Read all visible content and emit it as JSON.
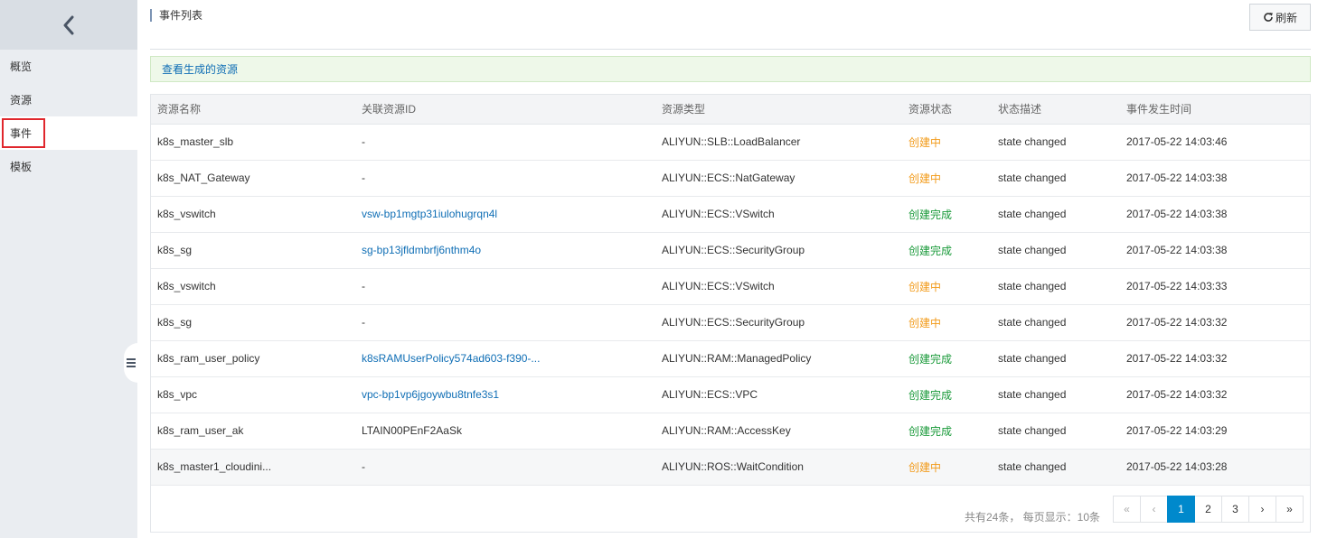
{
  "sidebar": {
    "items": [
      {
        "label": "概览",
        "active": false
      },
      {
        "label": "资源",
        "active": false
      },
      {
        "label": "事件",
        "active": true
      },
      {
        "label": "模板",
        "active": false
      }
    ]
  },
  "header": {
    "title": "事件列表",
    "refresh_label": "刷新"
  },
  "notice": {
    "link_text": "查看生成的资源"
  },
  "table": {
    "columns": [
      "资源名称",
      "关联资源ID",
      "资源类型",
      "资源状态",
      "状态描述",
      "事件发生时间"
    ],
    "rows": [
      {
        "name": "k8s_master_slb",
        "resource_id": "-",
        "id_is_link": false,
        "type": "ALIYUN::SLB::LoadBalancer",
        "status": "创建中",
        "status_kind": "orange",
        "desc": "state changed",
        "time": "2017-05-22 14:03:46"
      },
      {
        "name": "k8s_NAT_Gateway",
        "resource_id": "-",
        "id_is_link": false,
        "type": "ALIYUN::ECS::NatGateway",
        "status": "创建中",
        "status_kind": "orange",
        "desc": "state changed",
        "time": "2017-05-22 14:03:38"
      },
      {
        "name": "k8s_vswitch",
        "resource_id": "vsw-bp1mgtp31iulohugrqn4l",
        "id_is_link": true,
        "type": "ALIYUN::ECS::VSwitch",
        "status": "创建完成",
        "status_kind": "green",
        "desc": "state changed",
        "time": "2017-05-22 14:03:38"
      },
      {
        "name": "k8s_sg",
        "resource_id": "sg-bp13jfldmbrfj6nthm4o",
        "id_is_link": true,
        "type": "ALIYUN::ECS::SecurityGroup",
        "status": "创建完成",
        "status_kind": "green",
        "desc": "state changed",
        "time": "2017-05-22 14:03:38"
      },
      {
        "name": "k8s_vswitch",
        "resource_id": "-",
        "id_is_link": false,
        "type": "ALIYUN::ECS::VSwitch",
        "status": "创建中",
        "status_kind": "orange",
        "desc": "state changed",
        "time": "2017-05-22 14:03:33"
      },
      {
        "name": "k8s_sg",
        "resource_id": "-",
        "id_is_link": false,
        "type": "ALIYUN::ECS::SecurityGroup",
        "status": "创建中",
        "status_kind": "orange",
        "desc": "state changed",
        "time": "2017-05-22 14:03:32"
      },
      {
        "name": "k8s_ram_user_policy",
        "resource_id": "k8sRAMUserPolicy574ad603-f390-...",
        "id_is_link": true,
        "type": "ALIYUN::RAM::ManagedPolicy",
        "status": "创建完成",
        "status_kind": "green",
        "desc": "state changed",
        "time": "2017-05-22 14:03:32"
      },
      {
        "name": "k8s_vpc",
        "resource_id": "vpc-bp1vp6jgoywbu8tnfe3s1",
        "id_is_link": true,
        "type": "ALIYUN::ECS::VPC",
        "status": "创建完成",
        "status_kind": "green",
        "desc": "state changed",
        "time": "2017-05-22 14:03:32"
      },
      {
        "name": "k8s_ram_user_ak",
        "resource_id": "LTAIN00PEnF2AaSk",
        "id_is_link": false,
        "type": "ALIYUN::RAM::AccessKey",
        "status": "创建完成",
        "status_kind": "green",
        "desc": "state changed",
        "time": "2017-05-22 14:03:29"
      },
      {
        "name": "k8s_master1_cloudini...",
        "resource_id": "-",
        "id_is_link": false,
        "type": "ALIYUN::ROS::WaitCondition",
        "status": "创建中",
        "status_kind": "orange",
        "desc": "state changed",
        "time": "2017-05-22 14:03:28",
        "hover": true
      }
    ]
  },
  "pagination": {
    "summary": "共有24条， 每页显示：10条",
    "first": "«",
    "prev": "‹",
    "pages": [
      "1",
      "2",
      "3"
    ],
    "current": "1",
    "next": "›",
    "last": "»"
  },
  "colors": {
    "status_orange": "#f29b1a",
    "status_green": "#1a9a3a",
    "link_blue": "#0f6eb5",
    "pager_active": "#0089cc",
    "active_highlight": "#e0262c"
  },
  "icons": {
    "back": "chevron-left-icon",
    "refresh": "refresh-icon",
    "sidebar_toggle": "menu-icon"
  }
}
